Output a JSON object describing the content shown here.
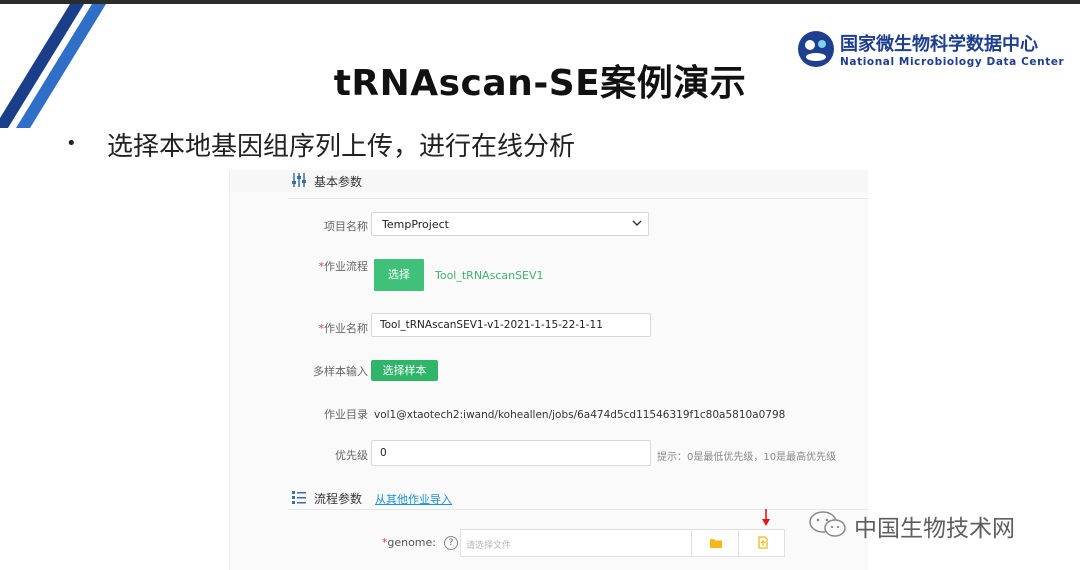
{
  "slide": {
    "title": "tRNAscan-SE案例演示",
    "bullet": "选择本地基因组序列上传，进行在线分析"
  },
  "logo": {
    "cn": "国家微生物科学数据中心",
    "en": "National Microbiology Data Center"
  },
  "form": {
    "basic_section_title": "基本参数",
    "project_name_label": "项目名称",
    "project_name_value": "TempProject",
    "workflow_label_req": "*",
    "workflow_label": "作业流程",
    "workflow_select_button": "选择",
    "workflow_value": "Tool_tRNAscanSEV1",
    "job_name_label_req": "*",
    "job_name_label": "作业名称",
    "job_name_value": "Tool_tRNAscanSEV1-v1-2021-1-15-22-1-11",
    "multi_sample_label": "多样本输入",
    "multi_sample_button": "选择样本",
    "job_dir_label": "作业目录",
    "job_dir_value": "vol1@xtaotech2:iwand/koheallen/jobs/6a474d5cd11546319f1c80a5810a0798",
    "priority_label": "优先级",
    "priority_value": "0",
    "priority_hint": "提示：0是最低优先级，10是最高优先级",
    "flow_section_title": "流程参数",
    "import_link": "从其他作业导入",
    "genome_label_req": "*",
    "genome_label": "genome:",
    "genome_help": "?",
    "genome_placeholder": "请选择文件"
  },
  "watermark": {
    "text": "中国生物技术网"
  },
  "colors": {
    "accent_green": "#3fc17a",
    "link_blue": "#1a8fd6",
    "required_red": "#e03a3a",
    "logo_blue": "#1e3f8f",
    "folder_yellow": "#f5b71a"
  }
}
